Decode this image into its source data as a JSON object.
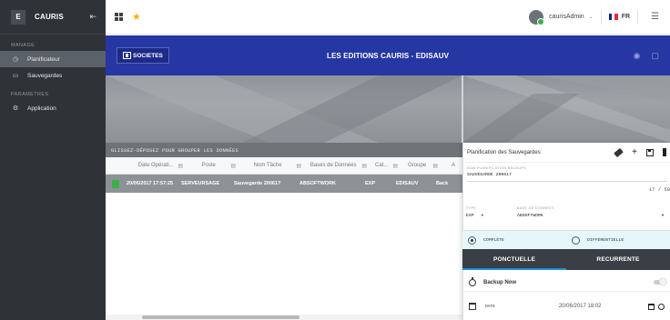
{
  "brand": {
    "badge": "E",
    "name": "CAURIS",
    "collapse_icon": "collapse-arrow-icon"
  },
  "sidebar": {
    "section_manage": "MANAGE",
    "section_parametres": "PARAMETRES",
    "items": [
      {
        "label": "Planificateur",
        "icon": "clock-icon",
        "active": true
      },
      {
        "label": "Sauvegardes",
        "icon": "folder-icon",
        "active": false
      },
      {
        "label": "Application",
        "icon": "gear-icon",
        "active": false
      }
    ]
  },
  "topbar": {
    "username": "caurisAdmin",
    "language": "FR",
    "flag_colors": [
      "#002395",
      "#ffffff",
      "#ed2939"
    ]
  },
  "banner": {
    "societes_label": "SOCIETES",
    "title": "LES EDITIONS CAURIS - EDISAUV"
  },
  "table": {
    "drop_hint": "GLISSEZ-DÉPOSEZ POUR GROUPER LES DONNÉES",
    "columns": [
      "Date Opérati...",
      "Poste",
      "Nom Tâche",
      "Bases de Données",
      "Cat...",
      "Groupe",
      "A"
    ],
    "rows": [
      {
        "date": "20/06/2017 17:57:25",
        "poste": "SERVEURSAGE",
        "tache": "Sauvegarde 20061?",
        "base": "ABSOFTWORK",
        "cat": "EXP",
        "groupe": "EDISAUV",
        "a": "Back"
      }
    ]
  },
  "panel": {
    "title": "Planification des Sauvegardes",
    "name_label": "NOM PLANIFICATION BACKUPS",
    "name_value": "SAUVEGARDE 200617",
    "counter": "17 / 50",
    "type_label": "TYPE",
    "type_value": "EXP",
    "base_label": "BASE DE DONNEES",
    "base_value": "ABSOFTWORK",
    "mode_complete": "COMPLÈTE",
    "mode_diff": "DIFFÉRENTIELLE",
    "tab_ponctuelle": "PONCTUELLE",
    "tab_recurrente": "RECURRENTE",
    "backup_now": "Backup Now",
    "date_label": "DATE",
    "date_value": "20/06/2017 18:02"
  }
}
